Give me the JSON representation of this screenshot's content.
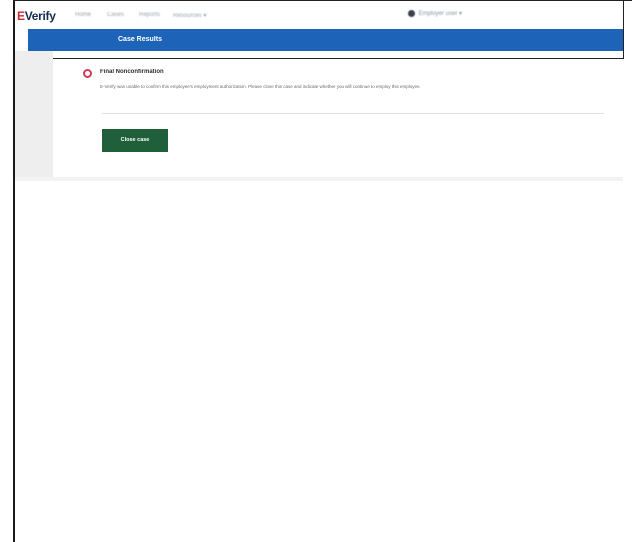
{
  "app": {
    "logo_prefix": "E",
    "logo_rest": "Verify"
  },
  "nav": {
    "items": [
      {
        "label": "Home"
      },
      {
        "label": "Cases"
      },
      {
        "label": "Reports"
      },
      {
        "label": "Resources"
      }
    ],
    "resources_chevron": "▾",
    "user_label": "Employer user",
    "user_chevron": "▾"
  },
  "header": {
    "title": "Case Results"
  },
  "alert": {
    "title": "Final Nonconfirmation",
    "body": "E-Verify was unable to confirm this employee's employment authorization. Please close this case and indicate whether you will continue to employ this employee."
  },
  "actions": {
    "close_case_label": "Close case"
  },
  "colors": {
    "brand_blue": "#1d64b8",
    "button_green": "#1f5f3a",
    "alert_red": "#d83a52"
  }
}
